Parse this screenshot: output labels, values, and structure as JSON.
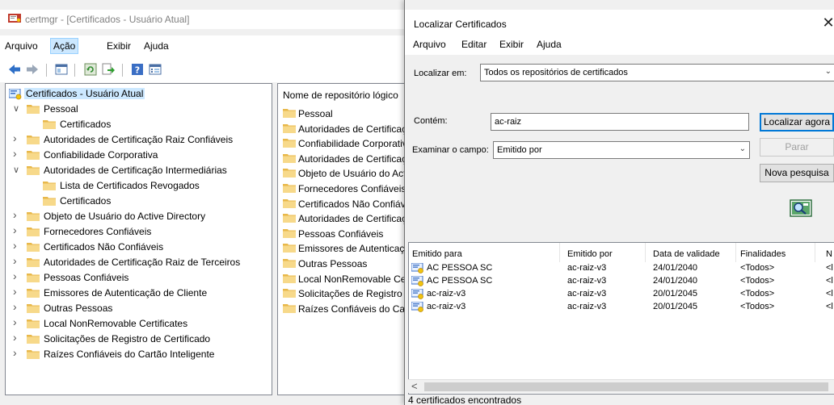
{
  "certmgr": {
    "title": "certmgr - [Certificados - Usuário Atual]",
    "menu": [
      "Arquivo",
      "Ação",
      "Exibir",
      "Ajuda"
    ],
    "toolbar_icons": [
      "back-arrow-icon",
      "forward-arrow-icon",
      "show-hide-tree-icon",
      "refresh-icon",
      "export-list-icon",
      "help-icon",
      "properties-icon"
    ],
    "tree": [
      {
        "label": "Certificados - Usuário Atual",
        "level": 0,
        "expander": "",
        "selected": true,
        "root": true
      },
      {
        "label": "Pessoal",
        "level": 1,
        "expander": "expanded"
      },
      {
        "label": "Certificados",
        "level": 2,
        "expander": ""
      },
      {
        "label": "Autoridades de Certificação Raiz Confiáveis",
        "level": 1,
        "expander": "collapsed"
      },
      {
        "label": "Confiabilidade Corporativa",
        "level": 1,
        "expander": "collapsed"
      },
      {
        "label": "Autoridades de Certificação Intermediárias",
        "level": 1,
        "expander": "expanded"
      },
      {
        "label": "Lista de Certificados Revogados",
        "level": 2,
        "expander": ""
      },
      {
        "label": "Certificados",
        "level": 2,
        "expander": ""
      },
      {
        "label": "Objeto de Usuário do Active Directory",
        "level": 1,
        "expander": "collapsed"
      },
      {
        "label": "Fornecedores Confiáveis",
        "level": 1,
        "expander": "collapsed"
      },
      {
        "label": "Certificados Não Confiáveis",
        "level": 1,
        "expander": "collapsed"
      },
      {
        "label": "Autoridades de Certificação Raiz de Terceiros",
        "level": 1,
        "expander": "collapsed"
      },
      {
        "label": "Pessoas Confiáveis",
        "level": 1,
        "expander": "collapsed"
      },
      {
        "label": "Emissores de Autenticação de Cliente",
        "level": 1,
        "expander": "collapsed"
      },
      {
        "label": "Outras Pessoas",
        "level": 1,
        "expander": "collapsed"
      },
      {
        "label": "Local NonRemovable Certificates",
        "level": 1,
        "expander": "collapsed"
      },
      {
        "label": "Solicitações de Registro de Certificado",
        "level": 1,
        "expander": "collapsed"
      },
      {
        "label": "Raízes Confiáveis do Cartão Inteligente",
        "level": 1,
        "expander": "collapsed"
      }
    ],
    "list_header": "Nome de repositório lógico",
    "list_items": [
      "Pessoal",
      "Autoridades de Certificação Raiz Confiáveis",
      "Confiabilidade Corporativa",
      "Autoridades de Certificação Intermediárias",
      "Objeto de Usuário do Active Directory",
      "Fornecedores Confiáveis",
      "Certificados Não Confiáveis",
      "Autoridades de Certificação Raiz de Terceiros",
      "Pessoas Confiáveis",
      "Emissores de Autenticação de Cliente",
      "Outras Pessoas",
      "Local NonRemovable Certificates",
      "Solicitações de Registro de Certificado",
      "Raízes Confiáveis do Cartão Inteligente"
    ]
  },
  "find_dialog": {
    "title": "Localizar Certificados",
    "close_glyph": "✕",
    "menu": [
      "Arquivo",
      "Editar",
      "Exibir",
      "Ajuda"
    ],
    "look_in_label": "Localizar em:",
    "look_in_value": "Todos os repositórios de certificados",
    "contains_label": "Contém:",
    "contains_value": "ac-raiz",
    "look_in_field_label": "Examinar o campo:",
    "look_in_field_value": "Emitido por",
    "find_now_button": "Localizar agora",
    "stop_button": "Parar",
    "new_search_button": "Nova pesquisa",
    "columns": [
      "Emitido para",
      "Emitido por",
      "Data de validade",
      "Finalidades",
      "N"
    ],
    "rows": [
      {
        "issued_to": "AC PESSOA SC",
        "issued_by": "ac-raiz-v3",
        "expiration": "24/01/2040",
        "purposes": "<Todos>",
        "more": "<l"
      },
      {
        "issued_to": "AC PESSOA SC",
        "issued_by": "ac-raiz-v3",
        "expiration": "24/01/2040",
        "purposes": "<Todos>",
        "more": "<l"
      },
      {
        "issued_to": "ac-raiz-v3",
        "issued_by": "ac-raiz-v3",
        "expiration": "20/01/2045",
        "purposes": "<Todos>",
        "more": "<l"
      },
      {
        "issued_to": "ac-raiz-v3",
        "issued_by": "ac-raiz-v3",
        "expiration": "20/01/2045",
        "purposes": "<Todos>",
        "more": "<l"
      }
    ],
    "scroll_left_glyph": "<",
    "status": "4 certificados encontrados"
  },
  "colors": {
    "selection": "#cce8ff",
    "folder": "#f4d27a",
    "accent": "#0078d7"
  }
}
